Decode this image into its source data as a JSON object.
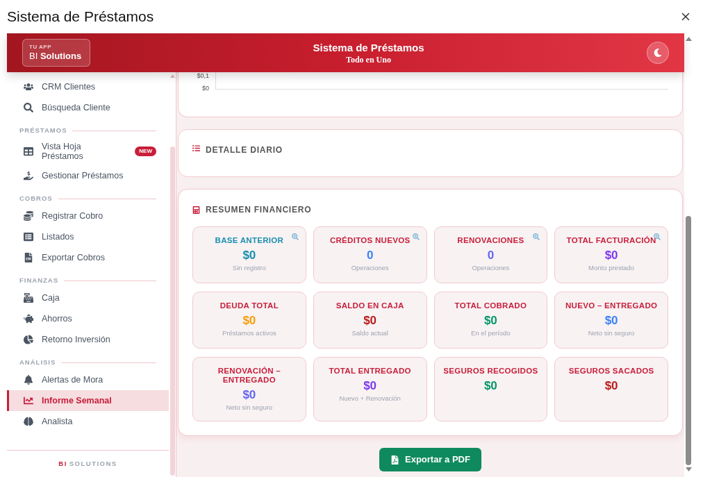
{
  "dialog": {
    "title": "Sistema de Préstamos"
  },
  "header": {
    "logo_caption": "TU APP",
    "logo_text": "BI **Solutions**",
    "title": "Sistema de Préstamos",
    "subtitle": "Todo en Uno"
  },
  "sidebar": {
    "sections": [
      {
        "items": [
          {
            "label": "CRM Clientes",
            "selected": false
          },
          {
            "label": "Búsqueda Cliente",
            "selected": false
          }
        ]
      },
      {
        "heading": "PRÉSTAMOS",
        "items": [
          {
            "label": "Vista Hoja Préstamos",
            "selected": false,
            "badge": "NEW"
          },
          {
            "label": "Gestionar Préstamos",
            "selected": false
          }
        ]
      },
      {
        "heading": "COBROS",
        "items": [
          {
            "label": "Registrar Cobro",
            "selected": false
          },
          {
            "label": "Listados",
            "selected": false
          },
          {
            "label": "Exportar Cobros",
            "selected": false
          }
        ]
      },
      {
        "heading": "FINANZAS",
        "items": [
          {
            "label": "Caja",
            "selected": false
          },
          {
            "label": "Ahorros",
            "selected": false
          },
          {
            "label": "Retorno Inversión",
            "selected": false
          }
        ]
      },
      {
        "heading": "ANÁLISIS",
        "items": [
          {
            "label": "Alertas de Mora",
            "selected": false
          },
          {
            "label": "Informe Semanal",
            "selected": true
          },
          {
            "label": "Analista",
            "selected": false
          }
        ]
      }
    ],
    "footer": {
      "brand": "BI",
      "text": "SOLUTIONS"
    }
  },
  "chart_fragment": {
    "y_tick_labels": [
      "$0,1",
      "$0"
    ]
  },
  "daily_detail": {
    "title": "DETALLE DIARIO"
  },
  "financial_summary": {
    "title": "RESUMEN FINANCIERO",
    "cards": [
      {
        "title": "BASE ANTERIOR",
        "value": "$0",
        "caption": "Sin registro",
        "kind": "highlight",
        "color": "#1a8fb0",
        "zoomable": true
      },
      {
        "title": "CRÉDITOS NUEVOS",
        "value": "0",
        "caption": "Operaciones",
        "kind": "standard",
        "color": "#3b82f6",
        "zoomable": true
      },
      {
        "title": "RENOVACIONES",
        "value": "0",
        "caption": "Operaciones",
        "kind": "standard",
        "color": "#6366f1",
        "zoomable": true
      },
      {
        "title": "TOTAL FACTURACIÓN",
        "value": "$0",
        "caption": "Monto prestado",
        "kind": "standard",
        "color": "#7c3aed",
        "zoomable": true
      },
      {
        "title": "DEUDA TOTAL",
        "value": "$0",
        "caption": "Préstamos activos",
        "kind": "standard",
        "color": "#f59e0b",
        "zoomable": false
      },
      {
        "title": "SALDO EN CAJA",
        "value": "$0",
        "caption": "Saldo actual",
        "kind": "standard",
        "color": "#b91c1c",
        "zoomable": false
      },
      {
        "title": "TOTAL COBRADO",
        "value": "$0",
        "caption": "En el período",
        "kind": "standard",
        "color": "#059669",
        "zoomable": false
      },
      {
        "title": "NUEVO – ENTREGADO",
        "value": "$0",
        "caption": "Neto sin seguro",
        "kind": "standard",
        "color": "#3b82f6",
        "zoomable": false
      },
      {
        "title": "RENOVACIÓN – ENTREGADO",
        "value": "$0",
        "caption": "Neto sin seguro",
        "kind": "standard",
        "color": "#6366f1",
        "zoomable": false
      },
      {
        "title": "TOTAL ENTREGADO",
        "value": "$0",
        "caption": "Nuevo + Renovación",
        "kind": "standard",
        "color": "#7c3aed",
        "zoomable": false
      },
      {
        "title": "SEGUROS RECOGIDOS",
        "value": "$0",
        "kind": "standard",
        "color": "#059669",
        "zoomable": false
      },
      {
        "title": "SEGUROS SACADOS",
        "value": "$0",
        "kind": "standard",
        "color": "#b91c1c",
        "zoomable": false
      }
    ]
  },
  "export_button": {
    "label": "Exportar a PDF"
  }
}
